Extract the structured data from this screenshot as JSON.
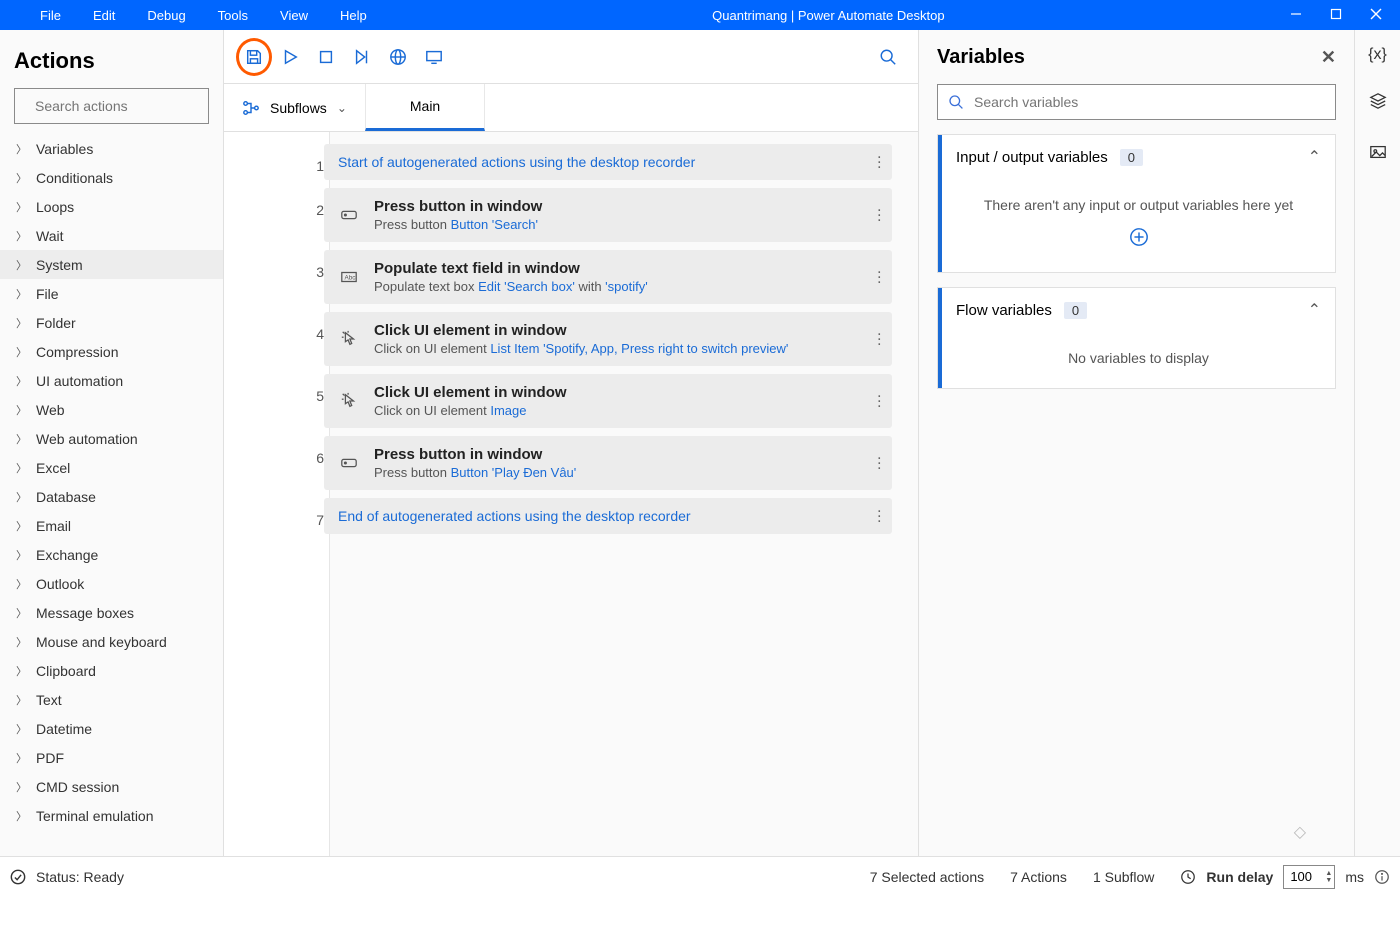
{
  "title": "Quantrimang | Power Automate Desktop",
  "menu": [
    "File",
    "Edit",
    "Debug",
    "Tools",
    "View",
    "Help"
  ],
  "actions": {
    "header": "Actions",
    "search_ph": "Search actions",
    "categories": [
      "Variables",
      "Conditionals",
      "Loops",
      "Wait",
      "System",
      "File",
      "Folder",
      "Compression",
      "UI automation",
      "Web",
      "Web automation",
      "Excel",
      "Database",
      "Email",
      "Exchange",
      "Outlook",
      "Message boxes",
      "Mouse and keyboard",
      "Clipboard",
      "Text",
      "Datetime",
      "PDF",
      "CMD session",
      "Terminal emulation"
    ],
    "selected": "System"
  },
  "subflows_label": "Subflows",
  "tab_main": "Main",
  "steps": [
    {
      "n": 1,
      "marker": true,
      "title": "Start of autogenerated actions using the desktop recorder"
    },
    {
      "n": 2,
      "icon": "button",
      "title": "Press button in window",
      "sub_pre": "Press button ",
      "links": [
        "Button 'Search'"
      ]
    },
    {
      "n": 3,
      "icon": "text",
      "title": "Populate text field in window",
      "sub_pre": "Populate text box ",
      "links": [
        "Edit 'Search box'"
      ],
      "mid": " with ",
      "links2": [
        "'spotify'"
      ]
    },
    {
      "n": 4,
      "icon": "click",
      "title": "Click UI element in window",
      "sub_pre": "Click on UI element ",
      "links": [
        "List Item 'Spotify, App, Press right to switch preview'"
      ]
    },
    {
      "n": 5,
      "icon": "click",
      "title": "Click UI element in window",
      "sub_pre": "Click on UI element ",
      "links": [
        "Image"
      ]
    },
    {
      "n": 6,
      "icon": "button",
      "title": "Press button in window",
      "sub_pre": "Press button ",
      "links": [
        "Button 'Play Đen Vâu'"
      ]
    },
    {
      "n": 7,
      "marker": true,
      "title": "End of autogenerated actions using the desktop recorder"
    }
  ],
  "vars": {
    "header": "Variables",
    "search_ph": "Search variables",
    "io_title": "Input / output variables",
    "io_count": "0",
    "io_empty": "There aren't any input or output variables here yet",
    "flow_title": "Flow variables",
    "flow_count": "0",
    "flow_empty": "No variables to display"
  },
  "status": {
    "ready": "Status: Ready",
    "sel": "7 Selected actions",
    "act": "7 Actions",
    "sub": "1 Subflow",
    "delay_label": "Run delay",
    "delay_value": "100",
    "ms": "ms"
  },
  "watermark": "Quantrimang"
}
